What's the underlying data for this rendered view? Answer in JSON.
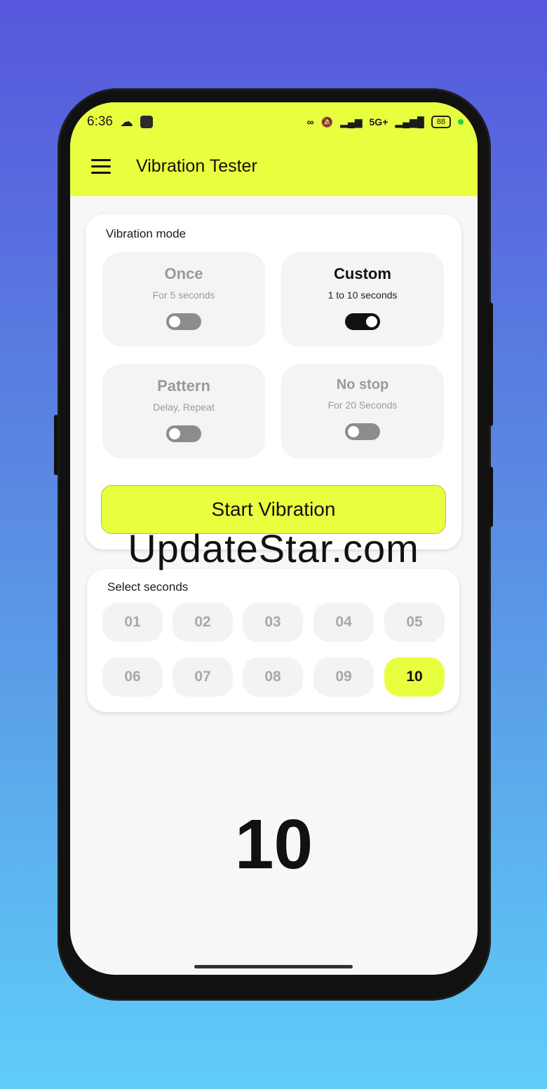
{
  "status_bar": {
    "time": "6:36",
    "battery": "88",
    "network": "5G+"
  },
  "app": {
    "title": "Vibration Tester"
  },
  "vibration_mode": {
    "label": "Vibration mode",
    "modes": [
      {
        "title": "Once",
        "subtitle": "For 5 seconds",
        "enabled": false
      },
      {
        "title": "Custom",
        "subtitle": "1 to 10 seconds",
        "enabled": true
      },
      {
        "title": "Pattern",
        "subtitle": "Delay, Repeat",
        "enabled": false
      },
      {
        "title": "No stop",
        "subtitle": "For 20 Seconds",
        "enabled": false
      }
    ],
    "start_label": "Start Vibration"
  },
  "select_seconds": {
    "label": "Select seconds",
    "options": [
      "01",
      "02",
      "03",
      "04",
      "05",
      "06",
      "07",
      "08",
      "09",
      "10"
    ],
    "selected": "10"
  },
  "display_value": "10",
  "watermark": "UpdateStar.com",
  "colors": {
    "accent": "#e8ff3f",
    "toggle_on": "#111111",
    "toggle_off": "#8c8c8c"
  }
}
